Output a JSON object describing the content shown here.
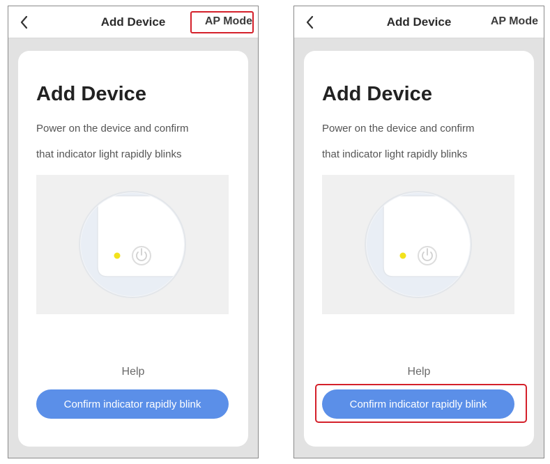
{
  "screens": [
    {
      "nav": {
        "title": "Add Device",
        "ap_mode_label": "AP Mode",
        "back_icon": "chevron-left-icon"
      },
      "card": {
        "title": "Add Device",
        "instruction_line1": "Power on the device and confirm",
        "instruction_line2": "that indicator light rapidly blinks",
        "help_label": "Help",
        "confirm_label": "Confirm indicator rapidly blink"
      },
      "highlighted": "ap-mode"
    },
    {
      "nav": {
        "title": "Add Device",
        "ap_mode_label": "AP Mode",
        "back_icon": "chevron-left-icon"
      },
      "card": {
        "title": "Add Device",
        "instruction_line1": "Power on the device and confirm",
        "instruction_line2": "that indicator light rapidly blinks",
        "help_label": "Help",
        "confirm_label": "Confirm indicator rapidly blink"
      },
      "highlighted": "confirm-button"
    }
  ],
  "colors": {
    "accent_button": "#5b8fe8",
    "highlight_box": "#d4202a",
    "indicator_light": "#f2e21c",
    "screen_background": "#e2e2e2"
  }
}
